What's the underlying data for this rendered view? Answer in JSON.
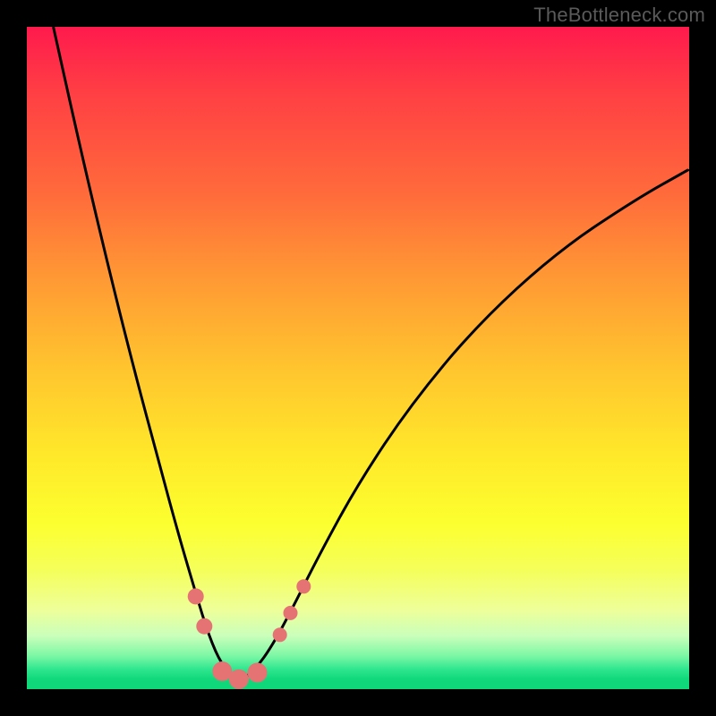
{
  "watermark": "TheBottleneck.com",
  "chart_data": {
    "type": "line",
    "title": "",
    "xlabel": "",
    "ylabel": "",
    "xlim": [
      0,
      1
    ],
    "ylim": [
      0,
      1
    ],
    "grid": false,
    "notes": "No axis ticks or numeric labels are rendered. Values are normalized 0–1 across the plot area; y increases downward visually (0 = top, 1 = bottom). The black curve is a V-shaped bottleneck curve with minimum near x≈0.32 touching the green band (y≈0.99).",
    "series": [
      {
        "name": "bottleneck-curve",
        "x": [
          0.04,
          0.08,
          0.12,
          0.16,
          0.2,
          0.23,
          0.255,
          0.275,
          0.295,
          0.32,
          0.345,
          0.37,
          0.4,
          0.44,
          0.5,
          0.58,
          0.68,
          0.8,
          0.92,
          1.0
        ],
        "y": [
          0.0,
          0.18,
          0.35,
          0.51,
          0.66,
          0.77,
          0.855,
          0.92,
          0.965,
          0.99,
          0.97,
          0.935,
          0.88,
          0.8,
          0.69,
          0.57,
          0.45,
          0.34,
          0.26,
          0.215
        ]
      }
    ],
    "markers": [
      {
        "name": "left-upper",
        "x": 0.255,
        "y": 0.86,
        "r": 9
      },
      {
        "name": "left-lower",
        "x": 0.268,
        "y": 0.905,
        "r": 9
      },
      {
        "name": "valley-left",
        "x": 0.295,
        "y": 0.973,
        "r": 11
      },
      {
        "name": "valley-mid",
        "x": 0.32,
        "y": 0.985,
        "r": 11
      },
      {
        "name": "valley-right",
        "x": 0.348,
        "y": 0.975,
        "r": 11
      },
      {
        "name": "right-lower",
        "x": 0.382,
        "y": 0.918,
        "r": 8
      },
      {
        "name": "right-mid",
        "x": 0.398,
        "y": 0.885,
        "r": 8
      },
      {
        "name": "right-upper",
        "x": 0.418,
        "y": 0.845,
        "r": 8
      }
    ],
    "colors": {
      "curve": "#000000",
      "marker_fill": "#e57373",
      "gradient_top": "#ff1a4d",
      "gradient_bottom": "#0fd879",
      "frame": "#000000",
      "watermark": "#5a5a5a"
    }
  }
}
